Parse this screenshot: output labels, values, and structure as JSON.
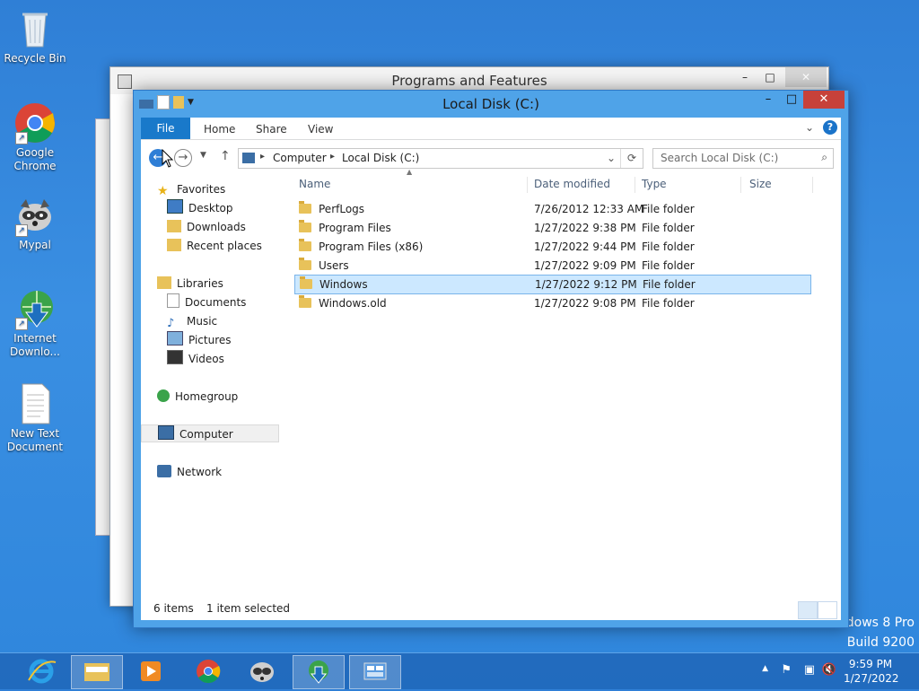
{
  "desktop": {
    "icons": [
      {
        "label": "Recycle Bin"
      },
      {
        "label": "Google Chrome"
      },
      {
        "label": "Mypal"
      },
      {
        "label": "Internet Downlo..."
      },
      {
        "label": "New Text Document"
      }
    ],
    "watermark_line1": "dows 8 Pro",
    "watermark_line2": "Build 9200"
  },
  "back_window": {
    "title": "Programs and Features",
    "min": "–",
    "max": "□",
    "close": "✕"
  },
  "explorer": {
    "title": "Local Disk (C:)",
    "min": "–",
    "max": "□",
    "close": "✕",
    "ribbon_tabs": {
      "file": "File",
      "home": "Home",
      "share": "Share",
      "view": "View"
    },
    "help": "?",
    "address": {
      "seg1": "Computer",
      "seg2": "Local Disk (C:)"
    },
    "search_placeholder": "Search Local Disk (C:)",
    "nav": {
      "favorites": "Favorites",
      "desktop": "Desktop",
      "downloads": "Downloads",
      "recent": "Recent places",
      "libraries": "Libraries",
      "documents": "Documents",
      "music": "Music",
      "pictures": "Pictures",
      "videos": "Videos",
      "homegroup": "Homegroup",
      "computer": "Computer",
      "network": "Network"
    },
    "columns": {
      "name": "Name",
      "date": "Date modified",
      "type": "Type",
      "size": "Size"
    },
    "rows": [
      {
        "name": "PerfLogs",
        "date": "7/26/2012 12:33 AM",
        "type": "File folder"
      },
      {
        "name": "Program Files",
        "date": "1/27/2022 9:38 PM",
        "type": "File folder"
      },
      {
        "name": "Program Files (x86)",
        "date": "1/27/2022 9:44 PM",
        "type": "File folder"
      },
      {
        "name": "Users",
        "date": "1/27/2022 9:09 PM",
        "type": "File folder"
      },
      {
        "name": "Windows",
        "date": "1/27/2022 9:12 PM",
        "type": "File folder",
        "selected": true
      },
      {
        "name": "Windows.old",
        "date": "1/27/2022 9:08 PM",
        "type": "File folder"
      }
    ],
    "status_items": "6 items",
    "status_selected": "1 item selected"
  },
  "taskbar": {
    "apps": [
      "internet-explorer-icon",
      "file-explorer-icon",
      "media-player-icon",
      "chrome-icon",
      "mypal-icon",
      "download-manager-icon",
      "control-panel-icon"
    ],
    "time": "9:59 PM",
    "date": "1/27/2022"
  },
  "colors": {
    "accent": "#1979ca",
    "selection": "#cce8ff",
    "close": "#c7413a"
  }
}
